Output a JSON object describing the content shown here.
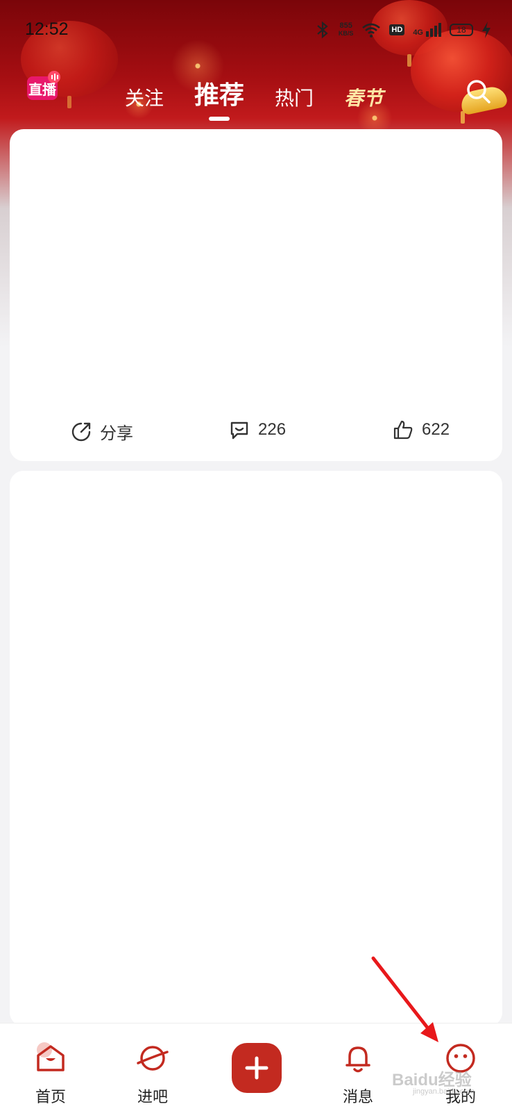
{
  "status_bar": {
    "time": "12:52",
    "net_speed_value": "855",
    "net_speed_unit": "KB/S",
    "hd": "HD",
    "signal": "4G",
    "battery": "18"
  },
  "top_nav": {
    "logo_text": "直播",
    "tabs": [
      {
        "label": "关注",
        "active": false
      },
      {
        "label": "推荐",
        "active": true
      },
      {
        "label": "热门",
        "active": false
      },
      {
        "label": "春节",
        "active": false
      }
    ]
  },
  "feed": {
    "post1": {
      "share_label": "分享",
      "comment_count": "226",
      "like_count": "622"
    }
  },
  "bottom_nav": {
    "items": [
      {
        "label": "首页",
        "icon": "home-icon"
      },
      {
        "label": "进吧",
        "icon": "planet-icon"
      },
      {
        "label": "",
        "icon": "plus-icon"
      },
      {
        "label": "消息",
        "icon": "bell-icon"
      },
      {
        "label": "我的",
        "icon": "smiley-icon"
      }
    ]
  },
  "watermark": {
    "text": "Baidu经验",
    "sub": "jingyan.baidu.com"
  },
  "colors": {
    "brand_red": "#c32a20",
    "header_dark_red": "#7a0509",
    "festival_gold": "#ffe7a6",
    "annotation_arrow": "#e8181b"
  }
}
